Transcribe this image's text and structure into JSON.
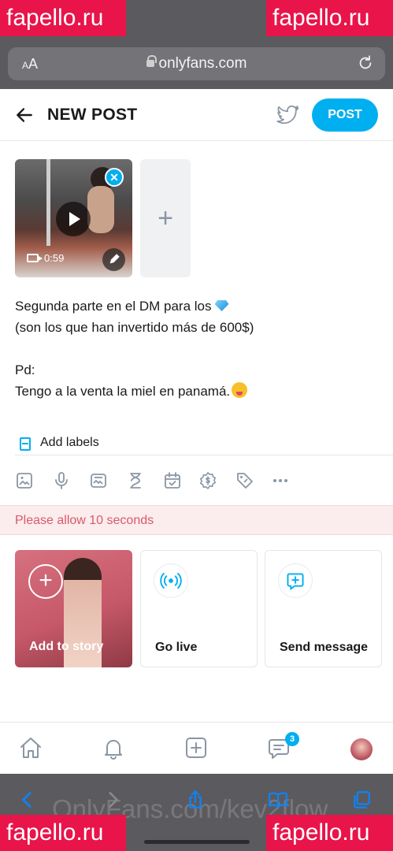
{
  "browser": {
    "aa_label": "AA",
    "url": "onlyfans.com"
  },
  "watermarks": {
    "top_left": "fapello.ru",
    "top_right": "fapello.ru",
    "bottom_left": "fapello.ru",
    "bottom_right": "fapello.ru",
    "footer_text": "OnlyFans.com/kev2flow"
  },
  "header": {
    "title": "NEW POST",
    "post_button": "POST"
  },
  "media": {
    "duration": "0:59",
    "add_symbol": "+"
  },
  "caption": {
    "lines": [
      "Segunda parte en el DM para los",
      "(son los que han invertido más de 600$)",
      "",
      "Pd:",
      "Tengo a la venta la miel en panamá."
    ]
  },
  "labels": {
    "add_labels": "Add labels"
  },
  "toolbar": {
    "icons": [
      "image-icon",
      "microphone-icon",
      "vault-icon",
      "hourglass-icon",
      "calendar-icon",
      "price-icon",
      "tag-icon",
      "more-icon"
    ]
  },
  "notice": {
    "text": "Please allow 10 seconds"
  },
  "cards": {
    "story": "Add to story",
    "live": "Go live",
    "message": "Send message"
  },
  "nav": {
    "messages_badge": "3"
  },
  "colors": {
    "accent": "#00aff0",
    "watermark": "#e8144a",
    "notice_bg": "#fbeced",
    "notice_text": "#d95a6a"
  }
}
